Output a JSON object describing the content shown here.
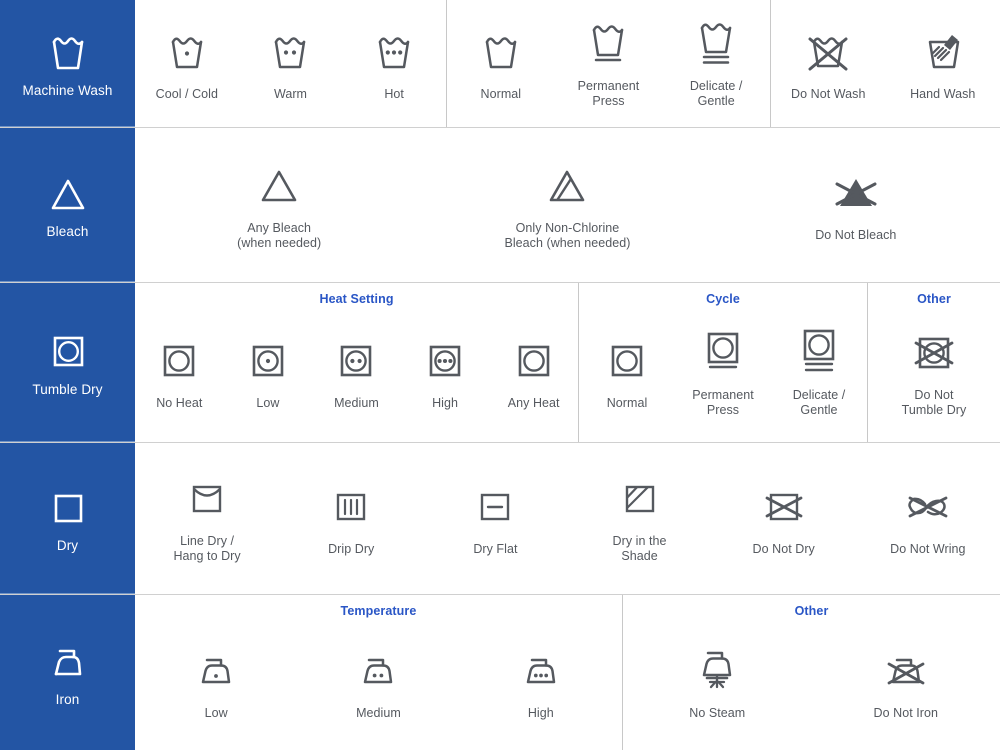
{
  "theme": {
    "sidebar_bg": "#2355a4",
    "sidebar_text": "#ffffff",
    "icon_stroke": "#55595f",
    "group_title_color": "#2a56c6",
    "divider": "#c8c8c8",
    "page_bg": "#ffffff"
  },
  "sections": [
    {
      "id": "machine-wash",
      "category_label": "Machine Wash",
      "category_icon": "washtub-icon",
      "groups": [
        {
          "title": "",
          "items": [
            {
              "label": "Cool  / Cold",
              "icon": "washtub-one-dot-icon"
            },
            {
              "label": "Warm",
              "icon": "washtub-two-dots-icon"
            },
            {
              "label": "Hot",
              "icon": "washtub-three-dots-icon"
            }
          ]
        },
        {
          "title": "",
          "items": [
            {
              "label": "Normal",
              "icon": "washtub-icon"
            },
            {
              "label": "Permanent\nPress",
              "icon": "washtub-one-bar-icon"
            },
            {
              "label": "Delicate /\nGentle",
              "icon": "washtub-two-bars-icon"
            }
          ]
        },
        {
          "title": "",
          "items": [
            {
              "label": "Do Not Wash",
              "icon": "washtub-crossed-icon"
            },
            {
              "label": "Hand Wash",
              "icon": "hand-wash-icon"
            }
          ]
        }
      ]
    },
    {
      "id": "bleach",
      "category_label": "Bleach",
      "category_icon": "triangle-icon",
      "groups": [
        {
          "title": "",
          "items": [
            {
              "label": "Any Bleach\n(when needed)",
              "icon": "triangle-icon"
            },
            {
              "label": "Only Non-Chlorine\nBleach (when needed)",
              "icon": "triangle-diagonal-lines-icon"
            },
            {
              "label": "Do Not Bleach",
              "icon": "triangle-filled-crossed-icon"
            }
          ]
        }
      ]
    },
    {
      "id": "tumble-dry",
      "category_label": "Tumble Dry",
      "category_icon": "tumble-dry-icon",
      "groups": [
        {
          "title": "Heat Setting",
          "items": [
            {
              "label": "No Heat",
              "icon": "tumble-dry-icon"
            },
            {
              "label": "Low",
              "icon": "tumble-dry-one-dot-icon"
            },
            {
              "label": "Medium",
              "icon": "tumble-dry-two-dots-icon"
            },
            {
              "label": "High",
              "icon": "tumble-dry-three-dots-icon"
            },
            {
              "label": "Any Heat",
              "icon": "tumble-dry-icon"
            }
          ]
        },
        {
          "title": "Cycle",
          "items": [
            {
              "label": "Normal",
              "icon": "tumble-dry-icon"
            },
            {
              "label": "Permanent\nPress",
              "icon": "tumble-dry-one-bar-icon"
            },
            {
              "label": "Delicate /\nGentle",
              "icon": "tumble-dry-two-bars-icon"
            }
          ]
        },
        {
          "title": "Other",
          "items": [
            {
              "label": "Do Not\nTumble Dry",
              "icon": "tumble-dry-crossed-icon"
            }
          ]
        }
      ]
    },
    {
      "id": "dry",
      "category_label": "Dry",
      "category_icon": "square-icon",
      "groups": [
        {
          "title": "",
          "items": [
            {
              "label": "Line Dry /\nHang to Dry",
              "icon": "line-dry-icon"
            },
            {
              "label": "Drip Dry",
              "icon": "drip-dry-icon"
            },
            {
              "label": "Dry Flat",
              "icon": "dry-flat-icon"
            },
            {
              "label": "Dry in the\nShade",
              "icon": "dry-in-shade-icon"
            },
            {
              "label": "Do Not Dry",
              "icon": "square-crossed-icon"
            },
            {
              "label": "Do Not Wring",
              "icon": "do-not-wring-icon"
            }
          ]
        }
      ]
    },
    {
      "id": "iron",
      "category_label": "Iron",
      "category_icon": "iron-icon",
      "groups": [
        {
          "title": "Temperature",
          "items": [
            {
              "label": "Low",
              "icon": "iron-one-dot-icon"
            },
            {
              "label": "Medium",
              "icon": "iron-two-dots-icon"
            },
            {
              "label": "High",
              "icon": "iron-three-dots-icon"
            }
          ]
        },
        {
          "title": "Other",
          "items": [
            {
              "label": "No Steam",
              "icon": "iron-no-steam-icon"
            },
            {
              "label": "Do Not Iron",
              "icon": "iron-crossed-icon"
            }
          ]
        }
      ]
    }
  ]
}
